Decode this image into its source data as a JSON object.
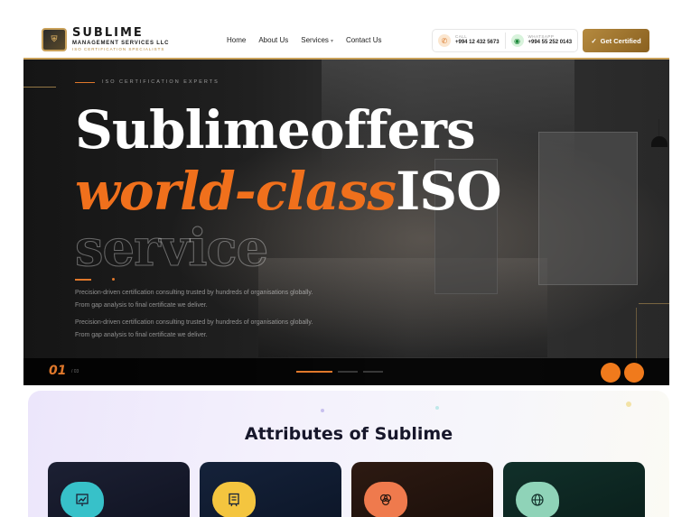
{
  "header": {
    "logo": {
      "badge_icon": "crest-logo-icon",
      "title": "SUBLIME",
      "subtitle": "MANAGEMENT SERVICES LLC",
      "tagline": "ISO CERTIFICATION SPECIALISTS"
    },
    "nav": [
      {
        "label": "Home"
      },
      {
        "label": "About Us"
      },
      {
        "label": "Services",
        "icon": "chevron-down-icon"
      },
      {
        "label": "Contact Us"
      }
    ],
    "call": {
      "label": "CALL",
      "number": "+994 12 432 5673",
      "icon": "phone-icon"
    },
    "whatsapp": {
      "label": "WHATSAPP",
      "number": "+994 55 252 0143",
      "icon": "whatsapp-icon"
    },
    "cta_label": "Get Certified",
    "cta_icon": "check-icon"
  },
  "hero": {
    "eyebrow": "ISO CERTIFICATION EXPERTS",
    "line1": "Sublimeoffers",
    "line2_accent": "world-class",
    "line2_white": "ISO",
    "line3_outline": "service",
    "description_1": "Precision-driven certification consulting trusted by hundreds of organisations globally. From gap analysis to final certificate we deliver.",
    "description_2": "Precision-driven certification consulting trusted by hundreds of organisations globally. From gap analysis to final certificate we deliver.",
    "slide_number": "01",
    "slide_total": "/ 03",
    "progress": [
      1,
      0,
      0
    ],
    "prev_icon": "arrow-left-icon",
    "next_icon": "arrow-right-icon",
    "accent_color": "#f0701c"
  },
  "attributes": {
    "title": "Attributes of Sublime",
    "cards": [
      {
        "icon": "chart-icon",
        "icon_color": "#37c1c9"
      },
      {
        "icon": "certificate-icon",
        "icon_color": "#f4c53f"
      },
      {
        "icon": "venn-icon",
        "icon_color": "#ef7a4d"
      },
      {
        "icon": "globe-icon",
        "icon_color": "#8fd3b8"
      }
    ]
  }
}
